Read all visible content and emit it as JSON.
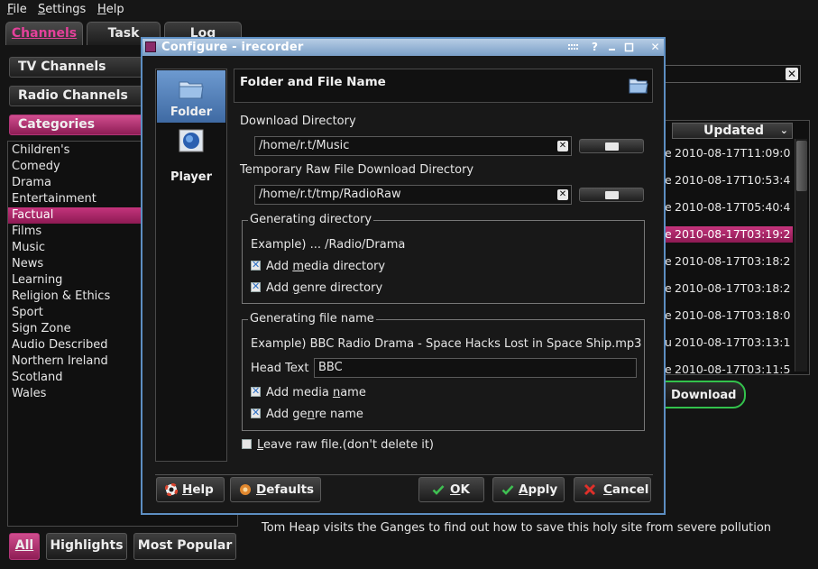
{
  "menubar": {
    "items": [
      {
        "label": "File",
        "mnemonic": "F",
        "rest": "ile"
      },
      {
        "label": "Settings",
        "mnemonic": "S",
        "rest": "ettings"
      },
      {
        "label": "Help",
        "mnemonic": "H",
        "rest": "elp"
      }
    ]
  },
  "main_tabs": {
    "channels": "Channels",
    "task": "Task",
    "log": "Log"
  },
  "sidebar": {
    "tv_channels": "TV Channels",
    "radio_channels": "Radio Channels",
    "categories": "Categories",
    "category_items": [
      "Children's",
      "Comedy",
      "Drama",
      "Entertainment",
      "Factual",
      "Films",
      "Music",
      "News",
      "Learning",
      "Religion & Ethics",
      "Sport",
      "Sign Zone",
      "Audio Described",
      "Northern Ireland",
      "Scotland",
      "Wales"
    ],
    "selected_category": "Factual"
  },
  "table": {
    "column_updated": "Updated",
    "rows": [
      {
        "lead": "e",
        "updated": "2010-08-17T11:09:0"
      },
      {
        "lead": "e",
        "updated": "2010-08-17T10:53:4"
      },
      {
        "lead": "e",
        "updated": "2010-08-17T05:40:4"
      },
      {
        "lead": "e",
        "updated": "2010-08-17T03:19:2",
        "selected": true
      },
      {
        "lead": "e",
        "updated": "2010-08-17T03:18:2"
      },
      {
        "lead": "e",
        "updated": "2010-08-17T03:18:2"
      },
      {
        "lead": "e",
        "updated": "2010-08-17T03:18:0"
      },
      {
        "lead": "u",
        "updated": "2010-08-17T03:13:1"
      },
      {
        "lead": "e",
        "updated": "2010-08-17T03:11:5"
      }
    ]
  },
  "download_button": "Download",
  "description": "Tom Heap visits the Ganges to find out how to save this holy site from severe pollution",
  "bottom_buttons": {
    "all": "All",
    "highlights": "Highlights",
    "most_popular": "Most Popular"
  },
  "dialog": {
    "title": "Configure - irecorder",
    "pages": [
      "Folder",
      "Player"
    ],
    "header_title": "Folder and File Name",
    "download_dir_label": "Download Directory",
    "download_dir_value": "/home/r.t/Music",
    "temp_dir_label": "Temporary Raw File Download Directory",
    "temp_dir_value": "/home/r.t/tmp/RadioRaw",
    "gen_dir": {
      "title": "Generating directory",
      "example": "Example) ... /Radio/Drama",
      "add_media_dir": {
        "pre": "Add ",
        "mn": "m",
        "post": "edia directory"
      },
      "add_genre_dir": {
        "pre": "Add ",
        "mn": "g",
        "post": "enre directory"
      }
    },
    "gen_file": {
      "title": "Generating file name",
      "example": "Example) BBC Radio Drama - Space Hacks Lost in Space Ship.mp3",
      "head_text_label": "Head Text",
      "head_text_value": "BBC",
      "add_media_name": {
        "pre": "Add media ",
        "mn": "n",
        "post": "ame"
      },
      "add_genre_name": {
        "pre": "Add ge",
        "mn": "n",
        "post": "re name"
      }
    },
    "leave_raw": {
      "mn": "L",
      "post": "eave raw file.(don't delete it)"
    },
    "buttons": {
      "help": {
        "mn": "H",
        "post": "elp"
      },
      "defaults": {
        "mn": "D",
        "post": "efaults"
      },
      "ok": {
        "mn": "O",
        "post": "K"
      },
      "apply": {
        "mn": "A",
        "post": "pply"
      },
      "cancel": {
        "mn": "C",
        "post": "ancel"
      }
    }
  },
  "colors": {
    "accent_pink": "#c4347c",
    "title_blue": "#7a9fc7",
    "download_green": "#33c24c"
  }
}
